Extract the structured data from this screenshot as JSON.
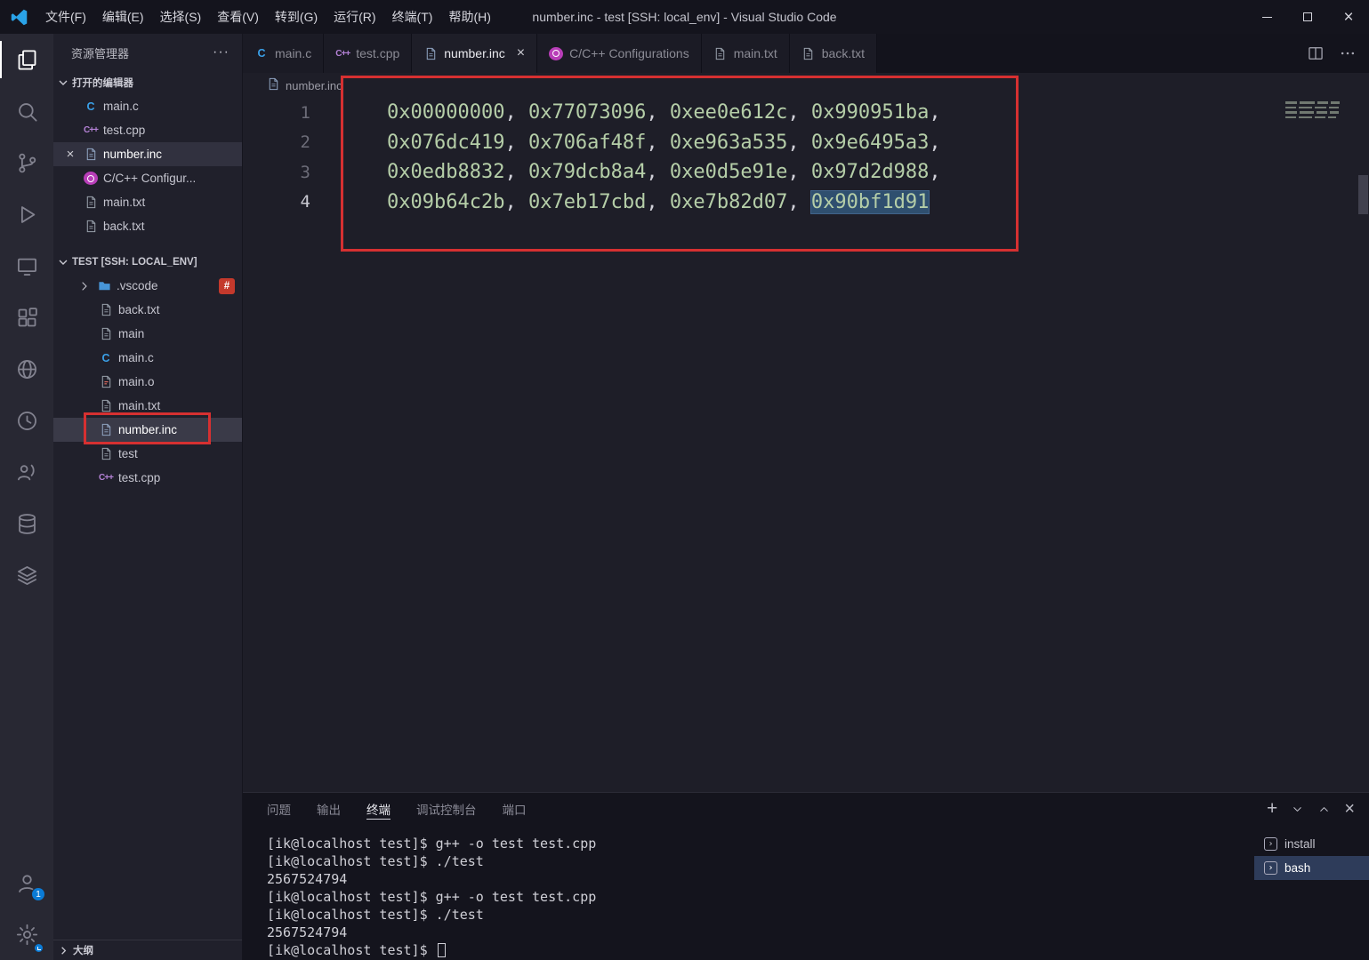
{
  "titlebar": {
    "title": "number.inc - test [SSH: local_env] - Visual Studio Code",
    "menus": [
      "文件(F)",
      "编辑(E)",
      "选择(S)",
      "查看(V)",
      "转到(G)",
      "运行(R)",
      "终端(T)",
      "帮助(H)"
    ],
    "window_controls": [
      "minimize-icon",
      "maximize-icon",
      "close-icon"
    ]
  },
  "activity_bar": {
    "items": [
      {
        "icon": "files-icon",
        "active": true
      },
      {
        "icon": "search-icon"
      },
      {
        "icon": "source-control-icon"
      },
      {
        "icon": "run-debug-icon"
      },
      {
        "icon": "remote-explorer-icon"
      },
      {
        "icon": "extensions-icon"
      },
      {
        "icon": "globe-icon"
      },
      {
        "icon": "history-icon"
      },
      {
        "icon": "live-share-icon"
      },
      {
        "icon": "database-icon"
      },
      {
        "icon": "layers-icon"
      }
    ],
    "bottom_items": [
      {
        "icon": "account-icon",
        "badge": "1"
      },
      {
        "icon": "settings-gear-icon",
        "badge": "clock"
      }
    ]
  },
  "sidebar": {
    "header": {
      "title": "资源管理器"
    },
    "open_editors": {
      "label": "打开的编辑器",
      "items": [
        {
          "label": "main.c",
          "icon": "c-file-icon"
        },
        {
          "label": "test.cpp",
          "icon": "cpp-file-icon"
        },
        {
          "label": "number.inc",
          "icon": "inc-file-icon",
          "active": true
        },
        {
          "label": "C/C++ Configur...",
          "icon": "cpp-config-icon"
        },
        {
          "label": "main.txt",
          "icon": "file-icon"
        },
        {
          "label": "back.txt",
          "icon": "file-icon"
        }
      ]
    },
    "tree": {
      "label": "TEST [SSH: LOCAL_ENV]",
      "items": [
        {
          "label": ".vscode",
          "icon": "vscode-folder-icon",
          "expandable": true,
          "badge": "#"
        },
        {
          "label": "back.txt",
          "icon": "file-icon"
        },
        {
          "label": "main",
          "icon": "file-icon"
        },
        {
          "label": "main.c",
          "icon": "c-file-icon"
        },
        {
          "label": "main.o",
          "icon": "binary-file-icon"
        },
        {
          "label": "main.txt",
          "icon": "file-icon"
        },
        {
          "label": "number.inc",
          "icon": "inc-file-icon",
          "selected": true,
          "annotated": true
        },
        {
          "label": "test",
          "icon": "file-icon"
        },
        {
          "label": "test.cpp",
          "icon": "cpp-file-icon"
        }
      ]
    },
    "outline": {
      "label": "大纲"
    }
  },
  "editor": {
    "tabs": [
      {
        "label": "main.c",
        "icon": "c-file-icon"
      },
      {
        "label": "test.cpp",
        "icon": "cpp-file-icon"
      },
      {
        "label": "number.inc",
        "icon": "inc-file-icon",
        "active": true
      },
      {
        "label": "C/C++ Configurations",
        "icon": "cpp-config-icon"
      },
      {
        "label": "main.txt",
        "icon": "file-icon"
      },
      {
        "label": "back.txt",
        "icon": "file-icon"
      }
    ],
    "breadcrumb": {
      "label": "number.inc",
      "icon": "inc-file-icon"
    },
    "code": {
      "lines": [
        {
          "num": "1",
          "values": [
            "0x00000000",
            "0x77073096",
            "0xee0e612c",
            "0x990951ba"
          ],
          "trailing_comma": true
        },
        {
          "num": "2",
          "values": [
            "0x076dc419",
            "0x706af48f",
            "0xe963a535",
            "0x9e6495a3"
          ],
          "trailing_comma": true
        },
        {
          "num": "3",
          "values": [
            "0x0edb8832",
            "0x79dcb8a4",
            "0xe0d5e91e",
            "0x97d2d988"
          ],
          "trailing_comma": true
        },
        {
          "num": "4",
          "values": [
            "0x09b64c2b",
            "0x7eb17cbd",
            "0xe7b82d07",
            "0x90bf1d91"
          ],
          "trailing_comma": false,
          "selected_index": 3,
          "active": true
        }
      ]
    }
  },
  "panel": {
    "tabs": [
      {
        "label": "问题"
      },
      {
        "label": "输出"
      },
      {
        "label": "终端",
        "active": true
      },
      {
        "label": "调试控制台"
      },
      {
        "label": "端口"
      }
    ],
    "actions": [
      "new-terminal-icon",
      "terminal-dropdown-icon",
      "maximize-panel-icon",
      "close-panel-icon"
    ],
    "terminal": {
      "lines": [
        "[ik@localhost test]$ g++ -o test test.cpp",
        "[ik@localhost test]$ ./test",
        "2567524794",
        "[ik@localhost test]$ g++ -o test test.cpp",
        "[ik@localhost test]$ ./test",
        "2567524794",
        "[ik@localhost test]$ "
      ],
      "cursor_on_last_line": true
    },
    "terminal_list": [
      {
        "label": "install",
        "icon": "terminal-icon"
      },
      {
        "label": "bash",
        "icon": "terminal-icon",
        "selected": true
      }
    ]
  },
  "annotations": {
    "color": "#d63031",
    "targets": [
      "editor-code-block",
      "sidebar-number-inc-row"
    ]
  },
  "colors": {
    "annotation_red": "#d63031",
    "hex_literal_green": "#b5cea8",
    "selection_blue": "#2f4f6f",
    "accent_blue": "#0a7bd6"
  }
}
